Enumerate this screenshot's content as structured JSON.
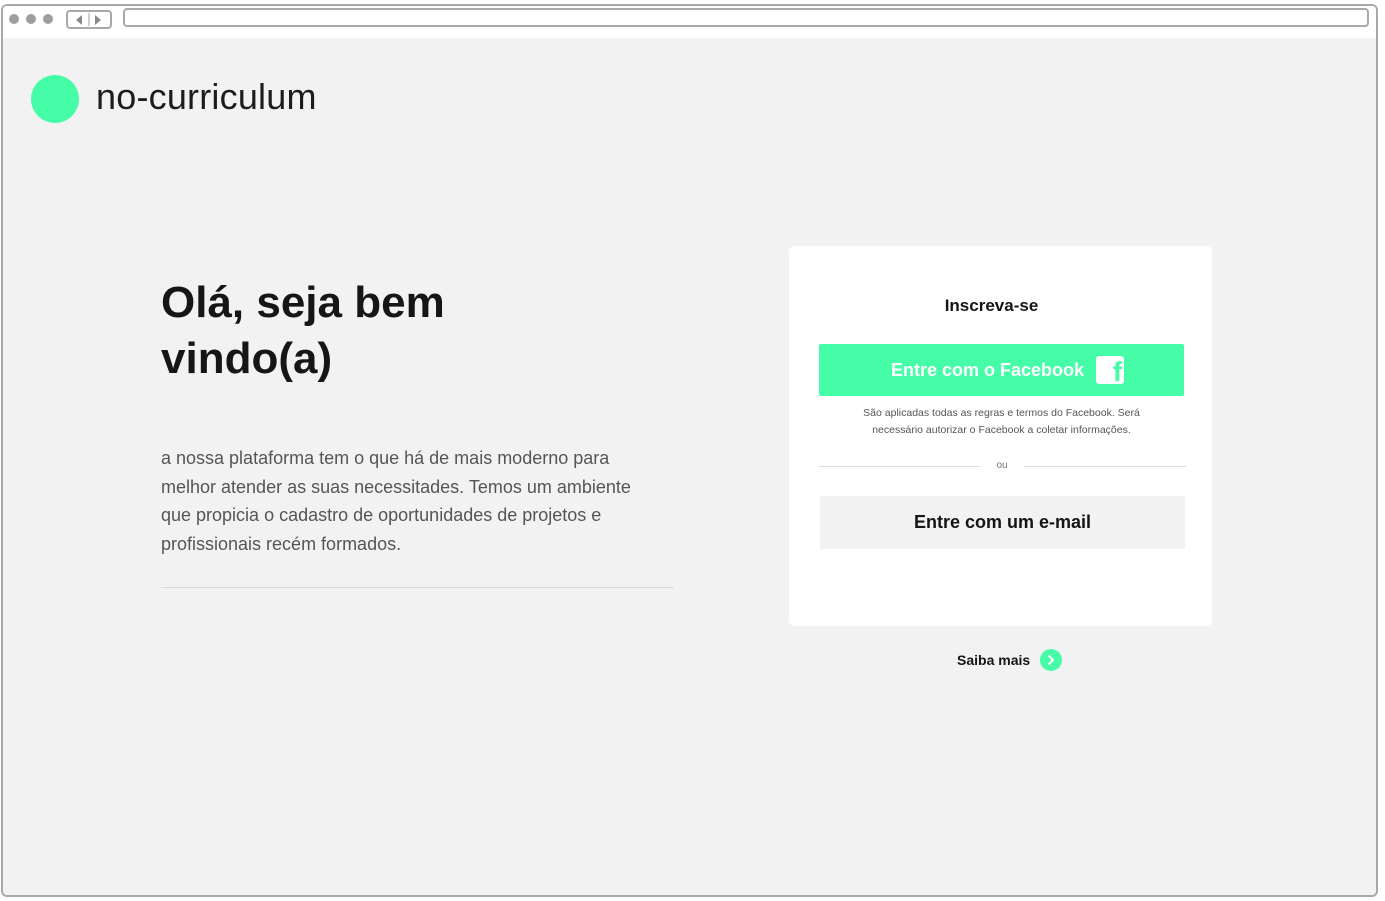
{
  "colors": {
    "accent": "#45fca7",
    "background": "#f2f2f2",
    "card": "#ffffff",
    "text_dark": "#151515",
    "text_muted": "#555555"
  },
  "brand": {
    "name": "no-curriculum",
    "logo_icon": "green-circle-logo"
  },
  "hero": {
    "headline": "Olá, seja bem vindo(a)",
    "intro": "a nossa plataforma tem o que há de mais moderno para melhor atender as suas necessitades. Temos um ambiente que propicia o cadastro de oportunidades de projetos e profissionais recém formados."
  },
  "signup": {
    "title": "Inscreva-se",
    "facebook_button": "Entre com o Facebook",
    "facebook_icon": "facebook-icon",
    "facebook_note": "São aplicadas todas as regras e termos do Facebook. Será necessário autorizar o Facebook a coletar informações.",
    "or_label": "ou",
    "email_button": "Entre com um e-mail"
  },
  "footer_link": {
    "label": "Saiba mais",
    "icon": "chevron-right-icon"
  }
}
